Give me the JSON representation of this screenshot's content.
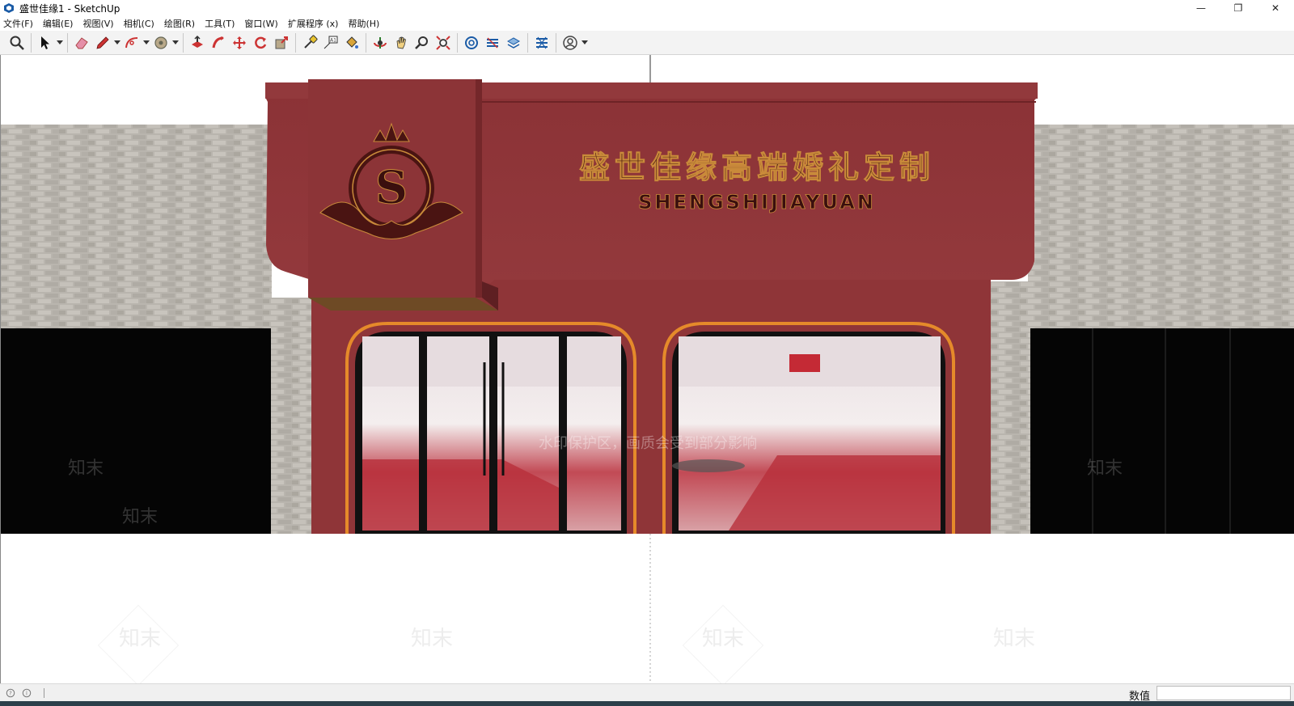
{
  "window": {
    "title": "盛世佳缘1 - SketchUp",
    "controls": {
      "minimize": "—",
      "restore": "❐",
      "close": "✕"
    }
  },
  "menu": [
    "文件(F)",
    "编辑(E)",
    "视图(V)",
    "相机(C)",
    "绘图(R)",
    "工具(T)",
    "窗口(W)",
    "扩展程序 (x)",
    "帮助(H)"
  ],
  "toolbar": {
    "tools": [
      "zoom-icon",
      "select-icon",
      "eraser-icon",
      "pencil-icon",
      "arc-icon",
      "shape-icon",
      "push-pull-icon",
      "follow-me-icon",
      "move-icon",
      "rotate-icon",
      "scale-icon",
      "tape-measure-icon",
      "text-icon",
      "paint-bucket-icon",
      "orbit-icon",
      "pan-icon",
      "zoom-tool-icon",
      "zoom-extents-icon",
      "warehouse-icon",
      "extension-warehouse-icon",
      "layout-icon",
      "extension-manager-icon",
      "account-icon"
    ]
  },
  "scene": {
    "sign_chinese": "盛世佳缘高端婚礼定制",
    "sign_english": "SHENGSHIJIAYUAN",
    "logo_letter": "S",
    "watermark_main": "水印保护区，画质会受到部分影响",
    "watermark_brand": "知末",
    "colors": {
      "facade_red": "#8f3538",
      "facade_dark": "#6e2326",
      "gold": "#c98a3a",
      "brick": "#b9b5ae"
    }
  },
  "status": {
    "measure_label": "数值",
    "measure_value": ""
  }
}
